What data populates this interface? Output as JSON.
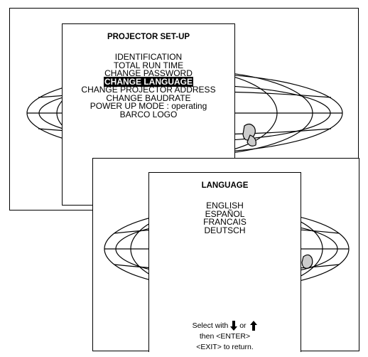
{
  "projector_setup": {
    "title": "PROJECTOR SET-UP",
    "items": [
      "IDENTIFICATION",
      "TOTAL RUN TIME",
      "CHANGE PASSWORD",
      "CHANGE LANGUAGE",
      "CHANGE PROJECTOR ADDRESS",
      "CHANGE BAUDRATE",
      "POWER UP MODE : operating",
      "BARCO LOGO"
    ],
    "selected_item": "CHANGE LANGUAGE"
  },
  "language_menu": {
    "title": "LANGUAGE",
    "items": [
      "ENGLISH",
      "ESPAÑOL",
      "FRANCAIS",
      "DEUTSCH"
    ],
    "help": {
      "select_prefix": "Select with",
      "or": "or",
      "line2": "then <ENTER>",
      "line3": "<EXIT> to return."
    }
  },
  "icons": [
    "globe-background",
    "arrow-down-icon",
    "arrow-up-icon"
  ]
}
